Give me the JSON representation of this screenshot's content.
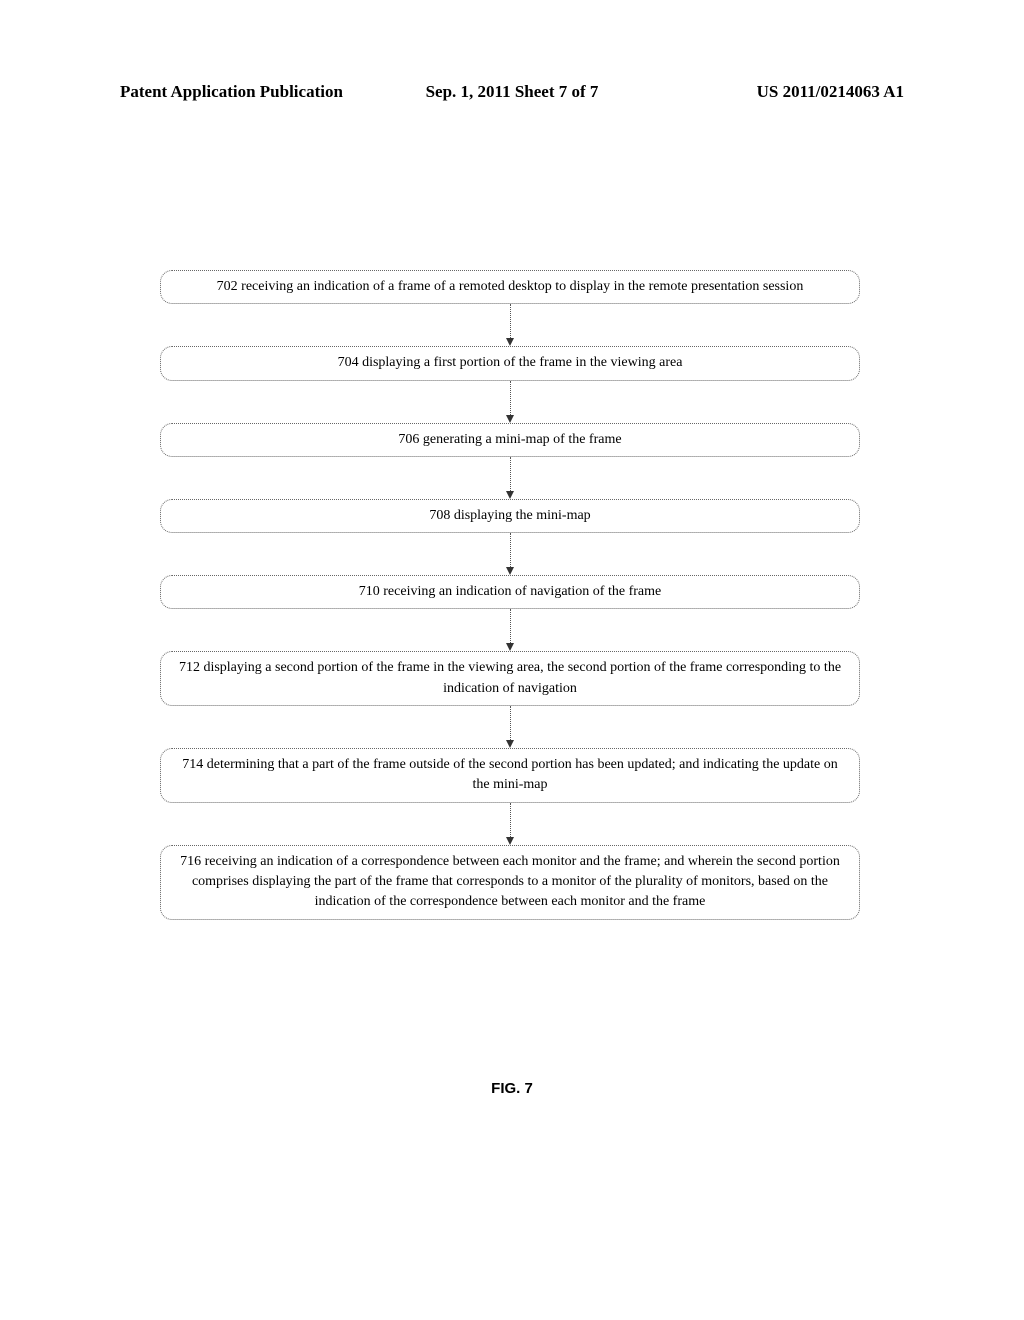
{
  "header": {
    "left": "Patent Application Publication",
    "center": "Sep. 1, 2011   Sheet 7 of 7",
    "right": "US 2011/0214063 A1"
  },
  "steps": [
    "702 receiving an indication of a frame of a remoted desktop to display in the remote presentation session",
    "704 displaying a first portion of the frame in the viewing area",
    "706 generating a mini-map of the frame",
    "708 displaying the mini-map",
    "710 receiving an indication of navigation of the frame",
    "712 displaying a second portion of the frame in the viewing area, the second portion of the frame corresponding to the indication of navigation",
    "714 determining that a part of the frame outside of the second portion has been updated; and indicating the update on the mini-map",
    "716 receiving an indication of a correspondence between each monitor and the frame; and wherein the second portion comprises displaying the part of the frame that corresponds to a monitor of the plurality of monitors, based on the indication of the correspondence between each monitor and the frame"
  ],
  "figure_label": "FIG. 7"
}
